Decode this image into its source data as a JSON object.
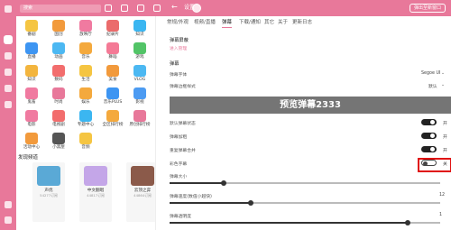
{
  "colors": {
    "accent": "#e8789a",
    "highlight": "#e01010",
    "toggle_on": "#222222",
    "preview_bg": "#757575"
  },
  "topbar": {
    "search_placeholder": "搜索",
    "back_icon": "arrow-left-icon",
    "title": "设置",
    "popout_label": "弹出至新窗口"
  },
  "rail": {
    "items": [
      "home-icon",
      "category-icon",
      "heart-icon",
      "favorite-icon",
      "star-icon",
      "history-icon"
    ],
    "active": 1
  },
  "categories": [
    {
      "label": "番剧",
      "color": "#f5c542"
    },
    {
      "label": "国创",
      "color": "#f29a3c"
    },
    {
      "label": "放映厅",
      "color": "#f07aa0"
    },
    {
      "label": "纪录片",
      "color": "#eb6b6b"
    },
    {
      "label": "知识",
      "color": "#3bb6f1"
    },
    {
      "label": "直播",
      "color": "#3d95f2"
    },
    {
      "label": "动画",
      "color": "#4cb8f2"
    },
    {
      "label": "音乐",
      "color": "#f4a93d"
    },
    {
      "label": "舞蹈",
      "color": "#f47a96"
    },
    {
      "label": "游戏",
      "color": "#52c467"
    },
    {
      "label": "知识",
      "color": "#f3b53e"
    },
    {
      "label": "数码",
      "color": "#f26d6d"
    },
    {
      "label": "生活",
      "color": "#f5c542"
    },
    {
      "label": "美食",
      "color": "#f29a3c"
    },
    {
      "label": "VLOG",
      "color": "#4cb8f2"
    },
    {
      "label": "鬼畜",
      "color": "#f07aa0"
    },
    {
      "label": "时尚",
      "color": "#e8789a"
    },
    {
      "label": "娱乐",
      "color": "#f4a93d"
    },
    {
      "label": "音乐PLUS",
      "color": "#3d95f2"
    },
    {
      "label": "影视",
      "color": "#4c9bf2"
    },
    {
      "label": "电影",
      "color": "#f07aa0"
    },
    {
      "label": "电视剧",
      "color": "#f26d6d"
    },
    {
      "label": "专题中心",
      "color": "#3bb6f1"
    },
    {
      "label": "全区排行榜",
      "color": "#f4a93d"
    },
    {
      "label": "原创排行榜",
      "color": "#e8789a"
    },
    {
      "label": "活动中心",
      "color": "#f29a3c"
    },
    {
      "label": "小黑屋",
      "color": "#555555"
    },
    {
      "label": "音频",
      "color": "#f5c542"
    }
  ],
  "discover": {
    "title": "发现频道",
    "cards": [
      {
        "name": "声优",
        "followers": "54277订阅",
        "color": "#5aa9d6"
      },
      {
        "name": "中文翻唱",
        "followers": "44817订阅",
        "color": "#c4a6e8"
      },
      {
        "name": "云顶之弈",
        "followers": "44864订阅",
        "color": "#8b5a4a"
      }
    ]
  },
  "tabs": [
    "常规/外观",
    "视频/直播",
    "弹幕",
    "下载/通知",
    "其它",
    "关于",
    "更新日志"
  ],
  "active_tab": 2,
  "danmaku": {
    "block_header": "弹幕屏蔽",
    "block_manage": "进入管理",
    "section": "弹幕",
    "font_label": "弹幕字体",
    "font_value": "Segoe UI",
    "style_label": "弹幕边框样式",
    "style_value": "默认",
    "preview_text": "预览弹幕2333",
    "options": [
      {
        "label": "默认弹幕状态",
        "state": "开",
        "on": true
      },
      {
        "label": "弹幕加粗",
        "state": "开",
        "on": true
      },
      {
        "label": "重复弹幕合并",
        "state": "开",
        "on": true
      },
      {
        "label": "彩色字幕",
        "state": "关",
        "on": false
      }
    ],
    "sliders": [
      {
        "label": "弹幕大小",
        "value": "",
        "fraction": 0.2
      },
      {
        "label": "弹幕速度(数值小越快)",
        "value": "12",
        "fraction": 0.3
      },
      {
        "label": "弹幕透明度",
        "value": "1",
        "fraction": 0.88
      }
    ]
  }
}
